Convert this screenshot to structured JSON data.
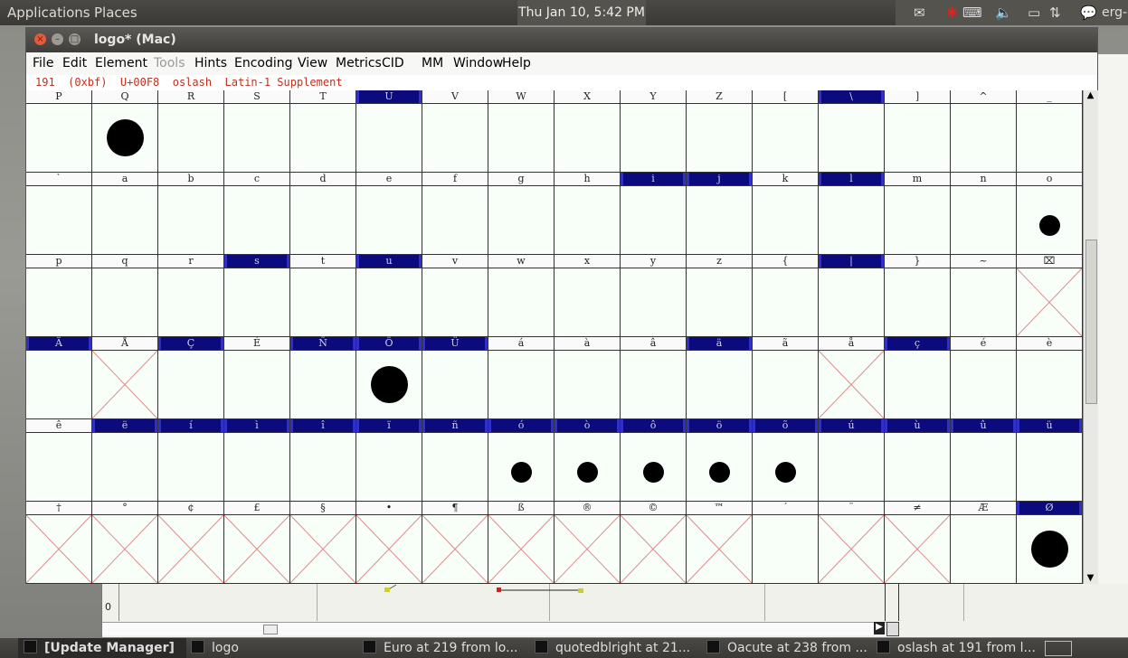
{
  "top_panel": {
    "applications": "Applications",
    "places": "Places",
    "clock": "Thu Jan 10,  5:42 PM",
    "user": "erg-"
  },
  "window": {
    "title": "logo*  (Mac)",
    "menu": [
      "File",
      "Edit",
      "Element",
      "Tools",
      "Hints",
      "Encoding",
      "View",
      "Metrics",
      "CID",
      "MM",
      "Window",
      "Help"
    ],
    "info": "191  (0xbf)  U+00F8  oslash  Latin-1 Supplement"
  },
  "glyph_rows": [
    [
      "P",
      "Q",
      "R",
      "S",
      "T",
      "U",
      "V",
      "W",
      "X",
      "Y",
      "Z",
      "[",
      "\\",
      "]",
      "^",
      "_"
    ],
    [
      "`",
      "a",
      "b",
      "c",
      "d",
      "e",
      "f",
      "g",
      "h",
      "i",
      "j",
      "k",
      "l",
      "m",
      "n",
      "o"
    ],
    [
      "p",
      "q",
      "r",
      "s",
      "t",
      "u",
      "v",
      "w",
      "x",
      "y",
      "z",
      "{",
      "|",
      "}",
      "~",
      ""
    ],
    [
      "Ä",
      "Å",
      "Ç",
      "É",
      "Ñ",
      "Ö",
      "Ü",
      "á",
      "à",
      "â",
      "ä",
      "ã",
      "å",
      "ç",
      "é",
      "è"
    ],
    [
      "ê",
      "ë",
      "í",
      "ì",
      "î",
      "ï",
      "ñ",
      "ó",
      "ò",
      "ô",
      "ö",
      "õ",
      "ú",
      "ù",
      "û",
      "ü"
    ],
    [
      "†",
      "°",
      "¢",
      "£",
      "§",
      "•",
      "¶",
      "ß",
      "®",
      "©",
      "™",
      "´",
      "¨",
      "≠",
      "Æ",
      "Ø"
    ]
  ],
  "selected_cells": [
    [
      0,
      5
    ],
    [
      0,
      12
    ],
    [
      1,
      9
    ],
    [
      1,
      10
    ],
    [
      1,
      12
    ],
    [
      2,
      3
    ],
    [
      2,
      5
    ],
    [
      2,
      12
    ],
    [
      3,
      0
    ],
    [
      3,
      2
    ],
    [
      3,
      4
    ],
    [
      3,
      5
    ],
    [
      3,
      6
    ],
    [
      3,
      10
    ],
    [
      3,
      13
    ],
    [
      4,
      1
    ],
    [
      4,
      2
    ],
    [
      4,
      3
    ],
    [
      4,
      4
    ],
    [
      4,
      5
    ],
    [
      4,
      6
    ],
    [
      4,
      7
    ],
    [
      4,
      8
    ],
    [
      4,
      9
    ],
    [
      4,
      10
    ],
    [
      4,
      11
    ],
    [
      4,
      12
    ],
    [
      4,
      13
    ],
    [
      4,
      14
    ],
    [
      4,
      15
    ],
    [
      5,
      15
    ]
  ],
  "empty_glyph_cells": [
    [
      2,
      15
    ],
    [
      3,
      1
    ],
    [
      3,
      12
    ],
    [
      5,
      0
    ],
    [
      5,
      1
    ],
    [
      5,
      2
    ],
    [
      5,
      3
    ],
    [
      5,
      4
    ],
    [
      5,
      5
    ],
    [
      5,
      6
    ],
    [
      5,
      7
    ],
    [
      5,
      8
    ],
    [
      5,
      9
    ],
    [
      5,
      10
    ],
    [
      5,
      12
    ],
    [
      5,
      13
    ]
  ],
  "glyph_dots": [
    {
      "cell": [
        0,
        1
      ],
      "size": "large"
    },
    {
      "cell": [
        1,
        15
      ],
      "size": "small"
    },
    {
      "cell": [
        3,
        5
      ],
      "size": "large"
    },
    {
      "cell": [
        4,
        7
      ],
      "size": "small"
    },
    {
      "cell": [
        4,
        8
      ],
      "size": "small"
    },
    {
      "cell": [
        4,
        9
      ],
      "size": "small"
    },
    {
      "cell": [
        4,
        10
      ],
      "size": "small"
    },
    {
      "cell": [
        4,
        11
      ],
      "size": "small"
    },
    {
      "cell": [
        5,
        15
      ],
      "size": "large"
    }
  ],
  "background_window": {
    "ruler_value": "0"
  },
  "taskbar": {
    "items": [
      {
        "label": "[Update Manager]",
        "active": true
      },
      {
        "label": "logo",
        "active": false
      },
      {
        "label": "Euro at 219 from lo...",
        "active": false
      },
      {
        "label": "quotedblright at 21...",
        "active": false
      },
      {
        "label": "Oacute at 238 from ...",
        "active": false
      },
      {
        "label": "oslash at 191 from l...",
        "active": false
      }
    ]
  },
  "colors": {
    "selected": "#0b0b7e",
    "empty_x": "#e08a8a",
    "info_text": "#c03020"
  }
}
